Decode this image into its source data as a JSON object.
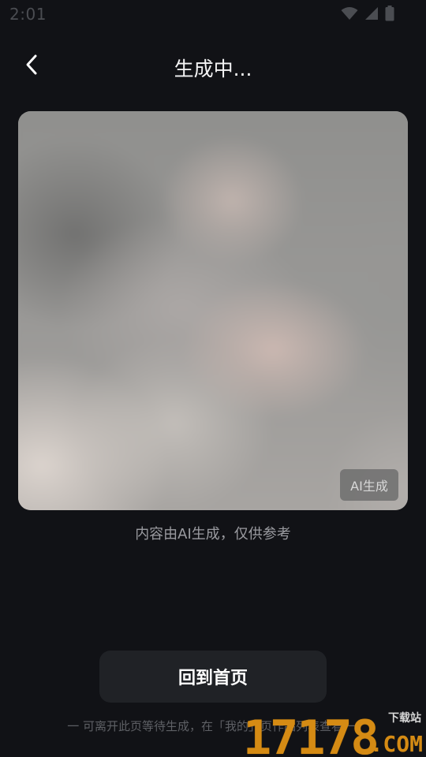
{
  "status_bar": {
    "time": "2:01",
    "icons": [
      "wifi-icon",
      "cellular-signal-icon",
      "battery-icon"
    ]
  },
  "header": {
    "title": "生成中...",
    "back_icon": "chevron-left-icon"
  },
  "preview": {
    "badge": "AI生成"
  },
  "disclaimer": "内容由AI生成，仅供参考",
  "home_button": {
    "label": "回到首页"
  },
  "footer_tip": "一 可离开此页等待生成，在「我的」页作品列表查看 一",
  "watermark": {
    "number": "17178",
    "domain": ".COM",
    "site": "下载站"
  },
  "colors": {
    "background": "#111216",
    "button_bg": "#202226",
    "watermark": "#d58b14"
  }
}
